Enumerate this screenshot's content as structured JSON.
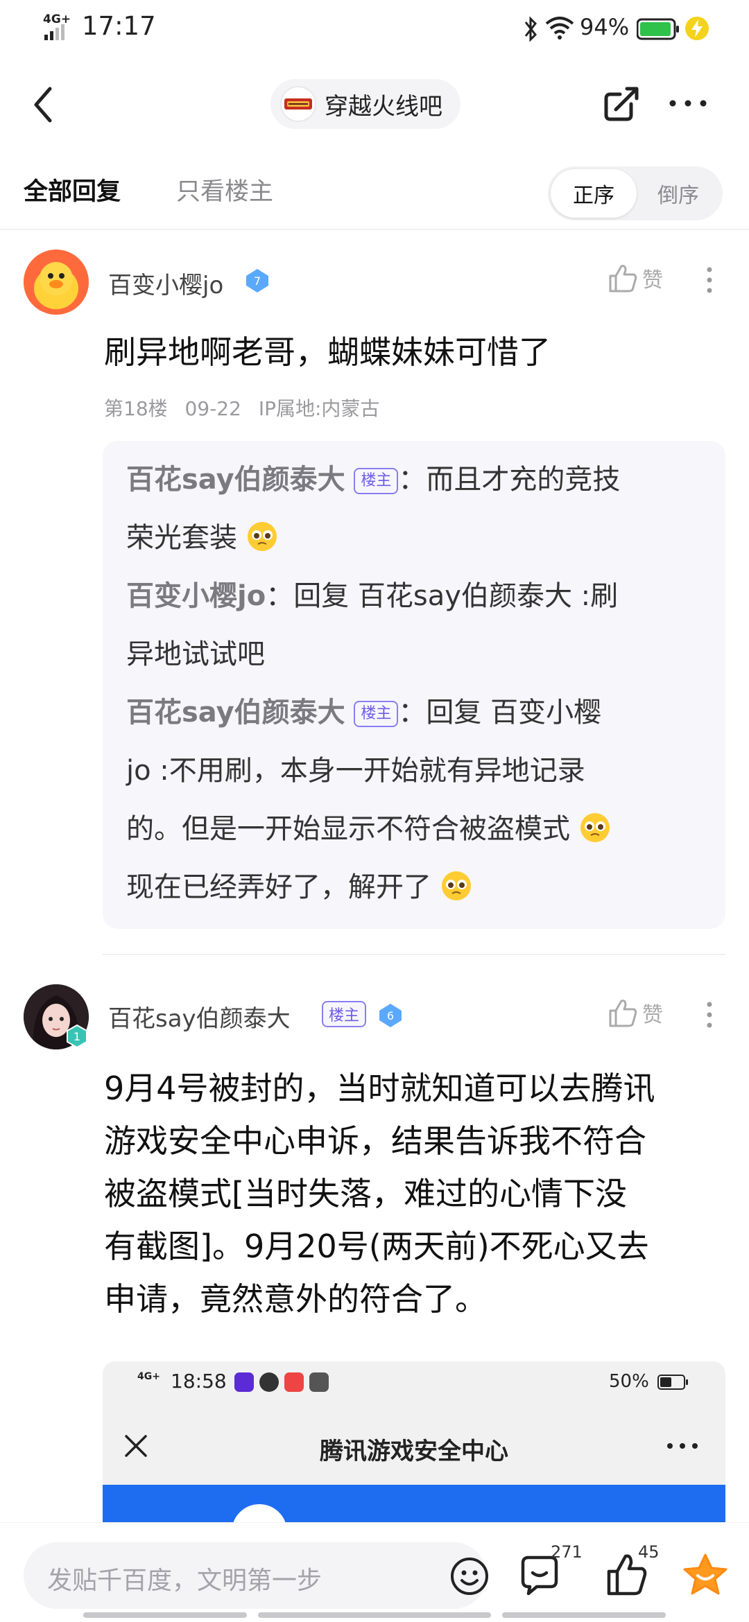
{
  "status_bar": {
    "network": "4G+",
    "time": "17:17",
    "battery_percent": "94%"
  },
  "nav": {
    "forum_name": "穿越火线吧"
  },
  "tabs": {
    "all_replies": "全部回复",
    "owner_only": "只看楼主",
    "sort_asc": "正序",
    "sort_desc": "倒序"
  },
  "post1": {
    "username": "百变小樱jo",
    "level": "7",
    "like_label": "赞",
    "content": "刷异地啊老哥，蝴蝶妹妹可惜了",
    "floor": "第18楼",
    "date": "09-22",
    "ip": "IP属地:内蒙古",
    "replies": [
      {
        "author": "百花say伯颜泰大",
        "badge": "楼主",
        "sep": "：",
        "line1": "而且才充的竞技",
        "line2": "荣光套装"
      },
      {
        "author": "百变小樱jo",
        "sep": "：",
        "line1": "回复 百花say伯颜泰大 :刷",
        "line2": "异地试试吧"
      },
      {
        "author": "百花say伯颜泰大",
        "badge": "楼主",
        "sep": "：",
        "line1": "回复 百变小樱",
        "line2": "jo :不用刷，本身一开始就有异地记录",
        "line3": "的。但是一开始显示不符合被盗模式",
        "line4": "现在已经弄好了，解开了"
      }
    ]
  },
  "post2": {
    "username": "百花say伯颜泰大",
    "badge": "楼主",
    "level": "6",
    "user_level": "1",
    "like_label": "赞",
    "content_lines": [
      "9月4号被封的，当时就知道可以去腾讯",
      "游戏安全中心申诉，结果告诉我不符合",
      "被盗模式[当时失落，难过的心情下没",
      "有截图]。9月20号(两天前)不死心又去",
      "申请，竟然意外的符合了。"
    ],
    "embedded_screenshot": {
      "network": "4G+",
      "time": "18:58",
      "battery_percent": "50%",
      "title": "腾讯游戏安全中心"
    }
  },
  "bottom_bar": {
    "input_placeholder": "发贴千百度，文明第一步",
    "comment_count": "271",
    "like_count": "45"
  },
  "colors": {
    "accent_blue": "#1e6df0",
    "louzhu_purple": "#6c5ce7",
    "star_orange": "#ff9a1f"
  }
}
